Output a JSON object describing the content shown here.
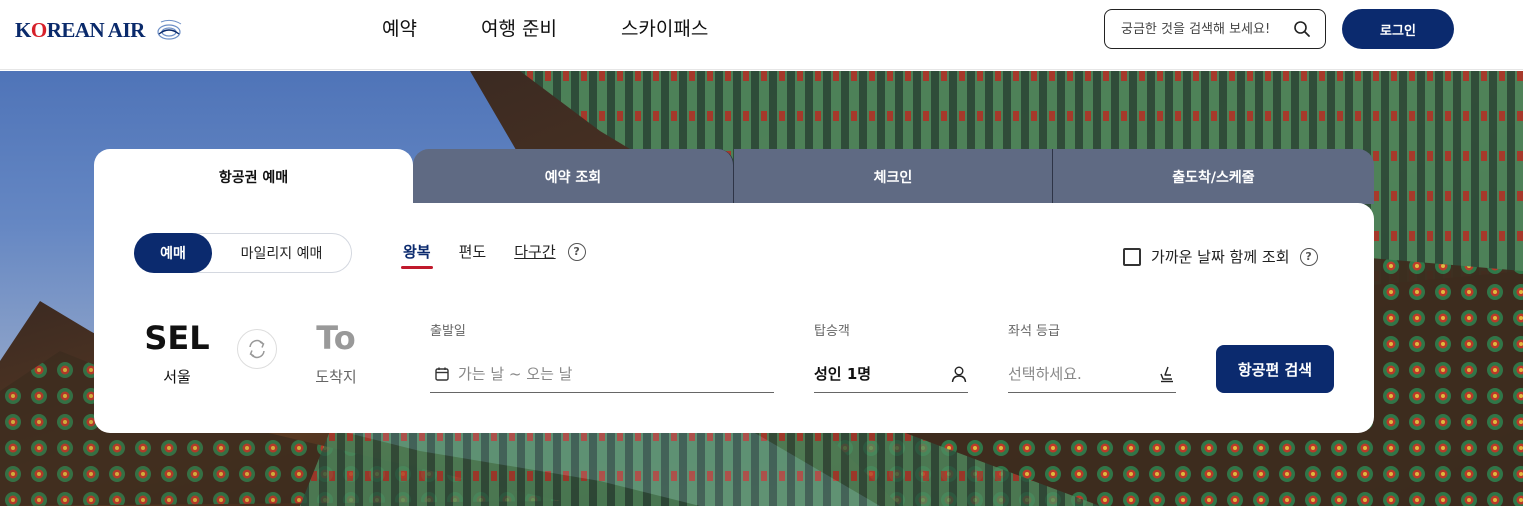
{
  "header": {
    "logo_text_k": "K",
    "logo_text_o": "O",
    "logo_text_rest": "REAN AIR",
    "nav": [
      "예약",
      "여행 준비",
      "스카이패스"
    ],
    "search_placeholder": "궁금한 것을 검색해 보세요!",
    "login_label": "로그인"
  },
  "tabs": [
    "항공권 예매",
    "예약 조회",
    "체크인",
    "출도착/스케줄"
  ],
  "booking": {
    "mode_active": "예매",
    "mode_other": "마일리지 예매",
    "trip_types": [
      "왕복",
      "편도",
      "다구간"
    ],
    "help_glyph": "?",
    "nearby_label": "가까운 날짜 함께 조회",
    "origin_code": "SEL",
    "origin_city": "서울",
    "dest_code": "To",
    "dest_city": "도착지",
    "date_label": "출발일",
    "date_placeholder": "가는 날 ~ 오는 날",
    "pax_label": "탑승객",
    "pax_value": "성인 1명",
    "seat_label": "좌석 등급",
    "seat_placeholder": "선택하세요.",
    "search_label": "항공편 검색"
  },
  "colors": {
    "brand_navy": "#0b2a6e",
    "tab_inactive": "#5f6a83",
    "trip_underline": "#c0192c"
  }
}
